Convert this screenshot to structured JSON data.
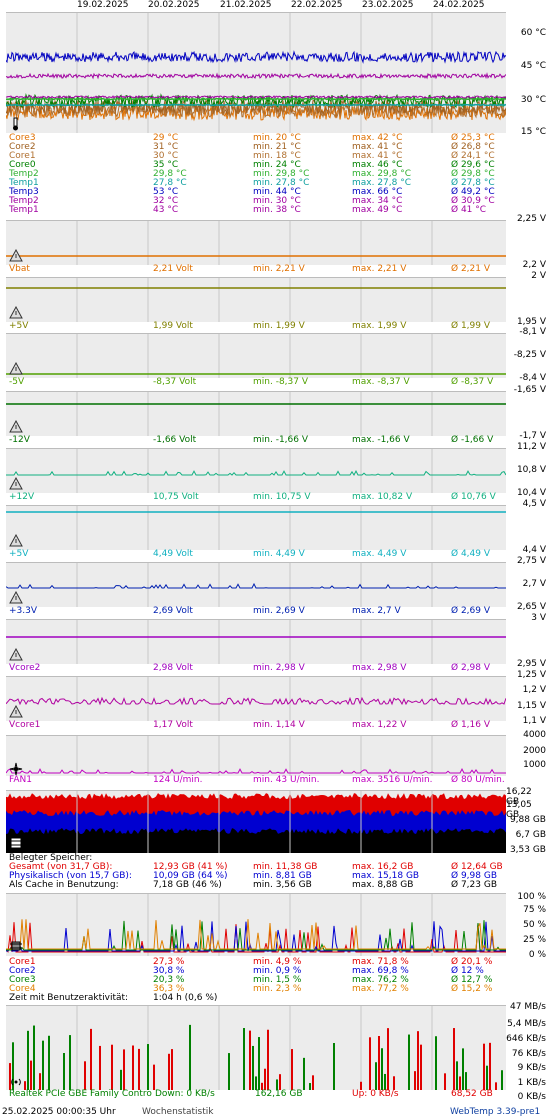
{
  "dates": [
    "19.02.2025",
    "20.02.2025",
    "21.02.2025",
    "22.02.2025",
    "23.02.2025",
    "24.02.2025"
  ],
  "colors": {
    "core3": "#e07000",
    "core2": "#a06020",
    "core1": "#b07030",
    "core0": "#008000",
    "temp2": "#30b030",
    "temp1": "#10a0a0",
    "temp3": "#0000c0",
    "temp2b": "#a000a0",
    "temp1b": "#a000a0",
    "vbat": "#e07000",
    "p5v": "#808000",
    "m5v": "#50a000",
    "m12v": "#007000",
    "p12v": "#10b080",
    "p5vb": "#10b0c0",
    "p33v": "#0020b0",
    "vcore2": "#a000c0",
    "vcore1": "#b000a0",
    "fan1": "#c000c0"
  },
  "temperature": {
    "axis": [
      "60 °C",
      "45 °C",
      "30 °C",
      "15 °C"
    ],
    "rows": [
      {
        "name": "Core3",
        "cur": "29 °C",
        "min": "min. 20 °C",
        "max": "max. 42 °C",
        "avg": "Ø 25,3 °C",
        "color": "#e07000"
      },
      {
        "name": "Core2",
        "cur": "31 °C",
        "min": "min. 21 °C",
        "max": "max. 41 °C",
        "avg": "Ø 26,8 °C",
        "color": "#a06020"
      },
      {
        "name": "Core1",
        "cur": "30 °C",
        "min": "min. 18 °C",
        "max": "max. 41 °C",
        "avg": "Ø 24,1 °C",
        "color": "#b07030"
      },
      {
        "name": "Core0",
        "cur": "35 °C",
        "min": "min. 24 °C",
        "max": "max. 46 °C",
        "avg": "Ø 29,6 °C",
        "color": "#008000"
      },
      {
        "name": "Temp2",
        "cur": "29,8 °C",
        "min": "min. 29,8 °C",
        "max": "max. 29,8 °C",
        "avg": "Ø 29,8 °C",
        "color": "#30b030"
      },
      {
        "name": "Temp1",
        "cur": "27,8 °C",
        "min": "min. 27,8 °C",
        "max": "max. 27,8 °C",
        "avg": "Ø 27,8 °C",
        "color": "#10a0a0"
      },
      {
        "name": "Temp3",
        "cur": "53 °C",
        "min": "min. 44 °C",
        "max": "max. 66 °C",
        "avg": "Ø 49,2 °C",
        "color": "#0000c0"
      },
      {
        "name": "Temp2",
        "cur": "32 °C",
        "min": "min. 30 °C",
        "max": "max. 34 °C",
        "avg": "Ø 30,9 °C",
        "color": "#a000a0"
      },
      {
        "name": "Temp1",
        "cur": "43 °C",
        "min": "min. 38 °C",
        "max": "max. 49 °C",
        "avg": "Ø 41 °C",
        "color": "#a000a0"
      }
    ]
  },
  "voltages": [
    {
      "key": "vbat",
      "axis": [
        "2,25 V",
        "2,2 V"
      ],
      "name": "Vbat",
      "cur": "2,21 Volt",
      "min": "min. 2,21 V",
      "max": "max. 2,21 V",
      "avg": "Ø 2,21 V",
      "color": "#e07000"
    },
    {
      "key": "p5v",
      "axis": [
        "2 V",
        "1,95 V"
      ],
      "name": "+5V",
      "cur": "1,99 Volt",
      "min": "min. 1,99 V",
      "max": "max. 1,99 V",
      "avg": "Ø 1,99 V",
      "color": "#808000"
    },
    {
      "key": "m5v",
      "axis": [
        "-8,1 V",
        "-8,25 V",
        "-8,4 V"
      ],
      "name": "-5V",
      "cur": "-8,37 Volt",
      "min": "min. -8,37 V",
      "max": "max. -8,37 V",
      "avg": "Ø -8,37 V",
      "color": "#50a000"
    },
    {
      "key": "m12v",
      "axis": [
        "-1,65 V",
        "-1,7 V"
      ],
      "name": "-12V",
      "cur": "-1,66 Volt",
      "min": "min. -1,66 V",
      "max": "max. -1,66 V",
      "avg": "Ø -1,66 V",
      "color": "#007000"
    },
    {
      "key": "p12v",
      "axis": [
        "11,2 V",
        "10,8 V",
        "10,4 V"
      ],
      "name": "+12V",
      "cur": "10,75 Volt",
      "min": "min. 10,75 V",
      "max": "max. 10,82 V",
      "avg": "Ø 10,76 V",
      "color": "#10b080"
    },
    {
      "key": "p5vb",
      "axis": [
        "4,5 V",
        "4,4 V"
      ],
      "name": "+5V",
      "cur": "4,49 Volt",
      "min": "min. 4,49 V",
      "max": "max. 4,49 V",
      "avg": "Ø 4,49 V",
      "color": "#10b0c0"
    },
    {
      "key": "p33v",
      "axis": [
        "2,75 V",
        "2,7 V",
        "2,65 V"
      ],
      "name": "+3.3V",
      "cur": "2,69 Volt",
      "min": "min. 2,69 V",
      "max": "max. 2,7 V",
      "avg": "Ø 2,69 V",
      "color": "#0020b0"
    },
    {
      "key": "vcore2",
      "axis": [
        "3 V",
        "2,95 V"
      ],
      "name": "Vcore2",
      "cur": "2,98 Volt",
      "min": "min. 2,98 V",
      "max": "max. 2,98 V",
      "avg": "Ø 2,98 V",
      "color": "#a000c0"
    },
    {
      "key": "vcore1",
      "axis": [
        "1,25 V",
        "1,2 V",
        "1,15 V",
        "1,1 V"
      ],
      "name": "Vcore1",
      "cur": "1,17 Volt",
      "min": "min. 1,14 V",
      "max": "max. 1,22 V",
      "avg": "Ø 1,16 V",
      "color": "#b000a0"
    }
  ],
  "fan": {
    "axis": [
      "4000",
      "2000",
      "1000"
    ],
    "name": "FAN1",
    "cur": "124 U/min.",
    "min": "min. 43 U/min.",
    "max": "max. 3516 U/min.",
    "avg": "Ø 80 U/min.",
    "color": "#c000c0"
  },
  "memory": {
    "axis": [
      "16,22 GB",
      "13,05 GB",
      "9,88 GB",
      "6,7 GB",
      "3,53 GB"
    ],
    "title": "Belegter Speicher:",
    "rows": [
      {
        "name": "Gesamt (von 31,7 GB):",
        "cur": "12,93 GB (41 %)",
        "min": "min. 11,38 GB",
        "max": "max. 16,2 GB",
        "avg": "Ø 12,64 GB",
        "color": "#e00000"
      },
      {
        "name": "Physikalisch (von 15,7 GB):",
        "cur": "10,09 GB (64 %)",
        "min": "min. 8,81 GB",
        "max": "max. 15,18 GB",
        "avg": "Ø 9,98 GB",
        "color": "#0000d0"
      },
      {
        "name": "Als Cache in Benutzung:",
        "cur": "7,18 GB (46 %)",
        "min": "min. 3,56 GB",
        "max": "max. 8,88 GB",
        "avg": "Ø 7,23 GB",
        "color": "#000000"
      }
    ]
  },
  "cpu": {
    "axis": [
      "100 %",
      "75 %",
      "50 %",
      "25 %",
      "0 %"
    ],
    "rows": [
      {
        "name": "Core1",
        "cur": "27,3 %",
        "min": "min. 4,9 %",
        "max": "max. 71,8 %",
        "avg": "Ø 20,1 %",
        "color": "#e00000"
      },
      {
        "name": "Core2",
        "cur": "30,8 %",
        "min": "min. 0,9 %",
        "max": "max. 69,8 %",
        "avg": "Ø 12 %",
        "color": "#0000d0"
      },
      {
        "name": "Core3",
        "cur": "20,3 %",
        "min": "min. 1,5 %",
        "max": "max. 76,2 %",
        "avg": "Ø 12,7 %",
        "color": "#008000"
      },
      {
        "name": "Core4",
        "cur": "36,3 %",
        "min": "min. 2,3 %",
        "max": "max. 77,2 %",
        "avg": "Ø 15,2 %",
        "color": "#e08000"
      }
    ],
    "activity_label": "Zeit mit Benutzeraktivität:",
    "activity_value": "1:04 h (0,6 %)"
  },
  "network": {
    "axis": [
      "47 MB/s",
      "5,4 MB/s",
      "646 KB/s",
      "76 KB/s",
      "9 KB/s",
      "1 KB/s",
      "0 KB/s"
    ],
    "name": "Realtek PCIe GBE Family Contro",
    "down": "Down: 0 KB/s",
    "down_total": "162,16 GB",
    "up": "Up: 0 KB/s",
    "up_total": "68,52 GB"
  },
  "footer": {
    "timestamp": "25.02.2025 00:00:35 Uhr",
    "mode": "Wochenstatistik",
    "brand": "WebTemp 3.39-pre1"
  }
}
